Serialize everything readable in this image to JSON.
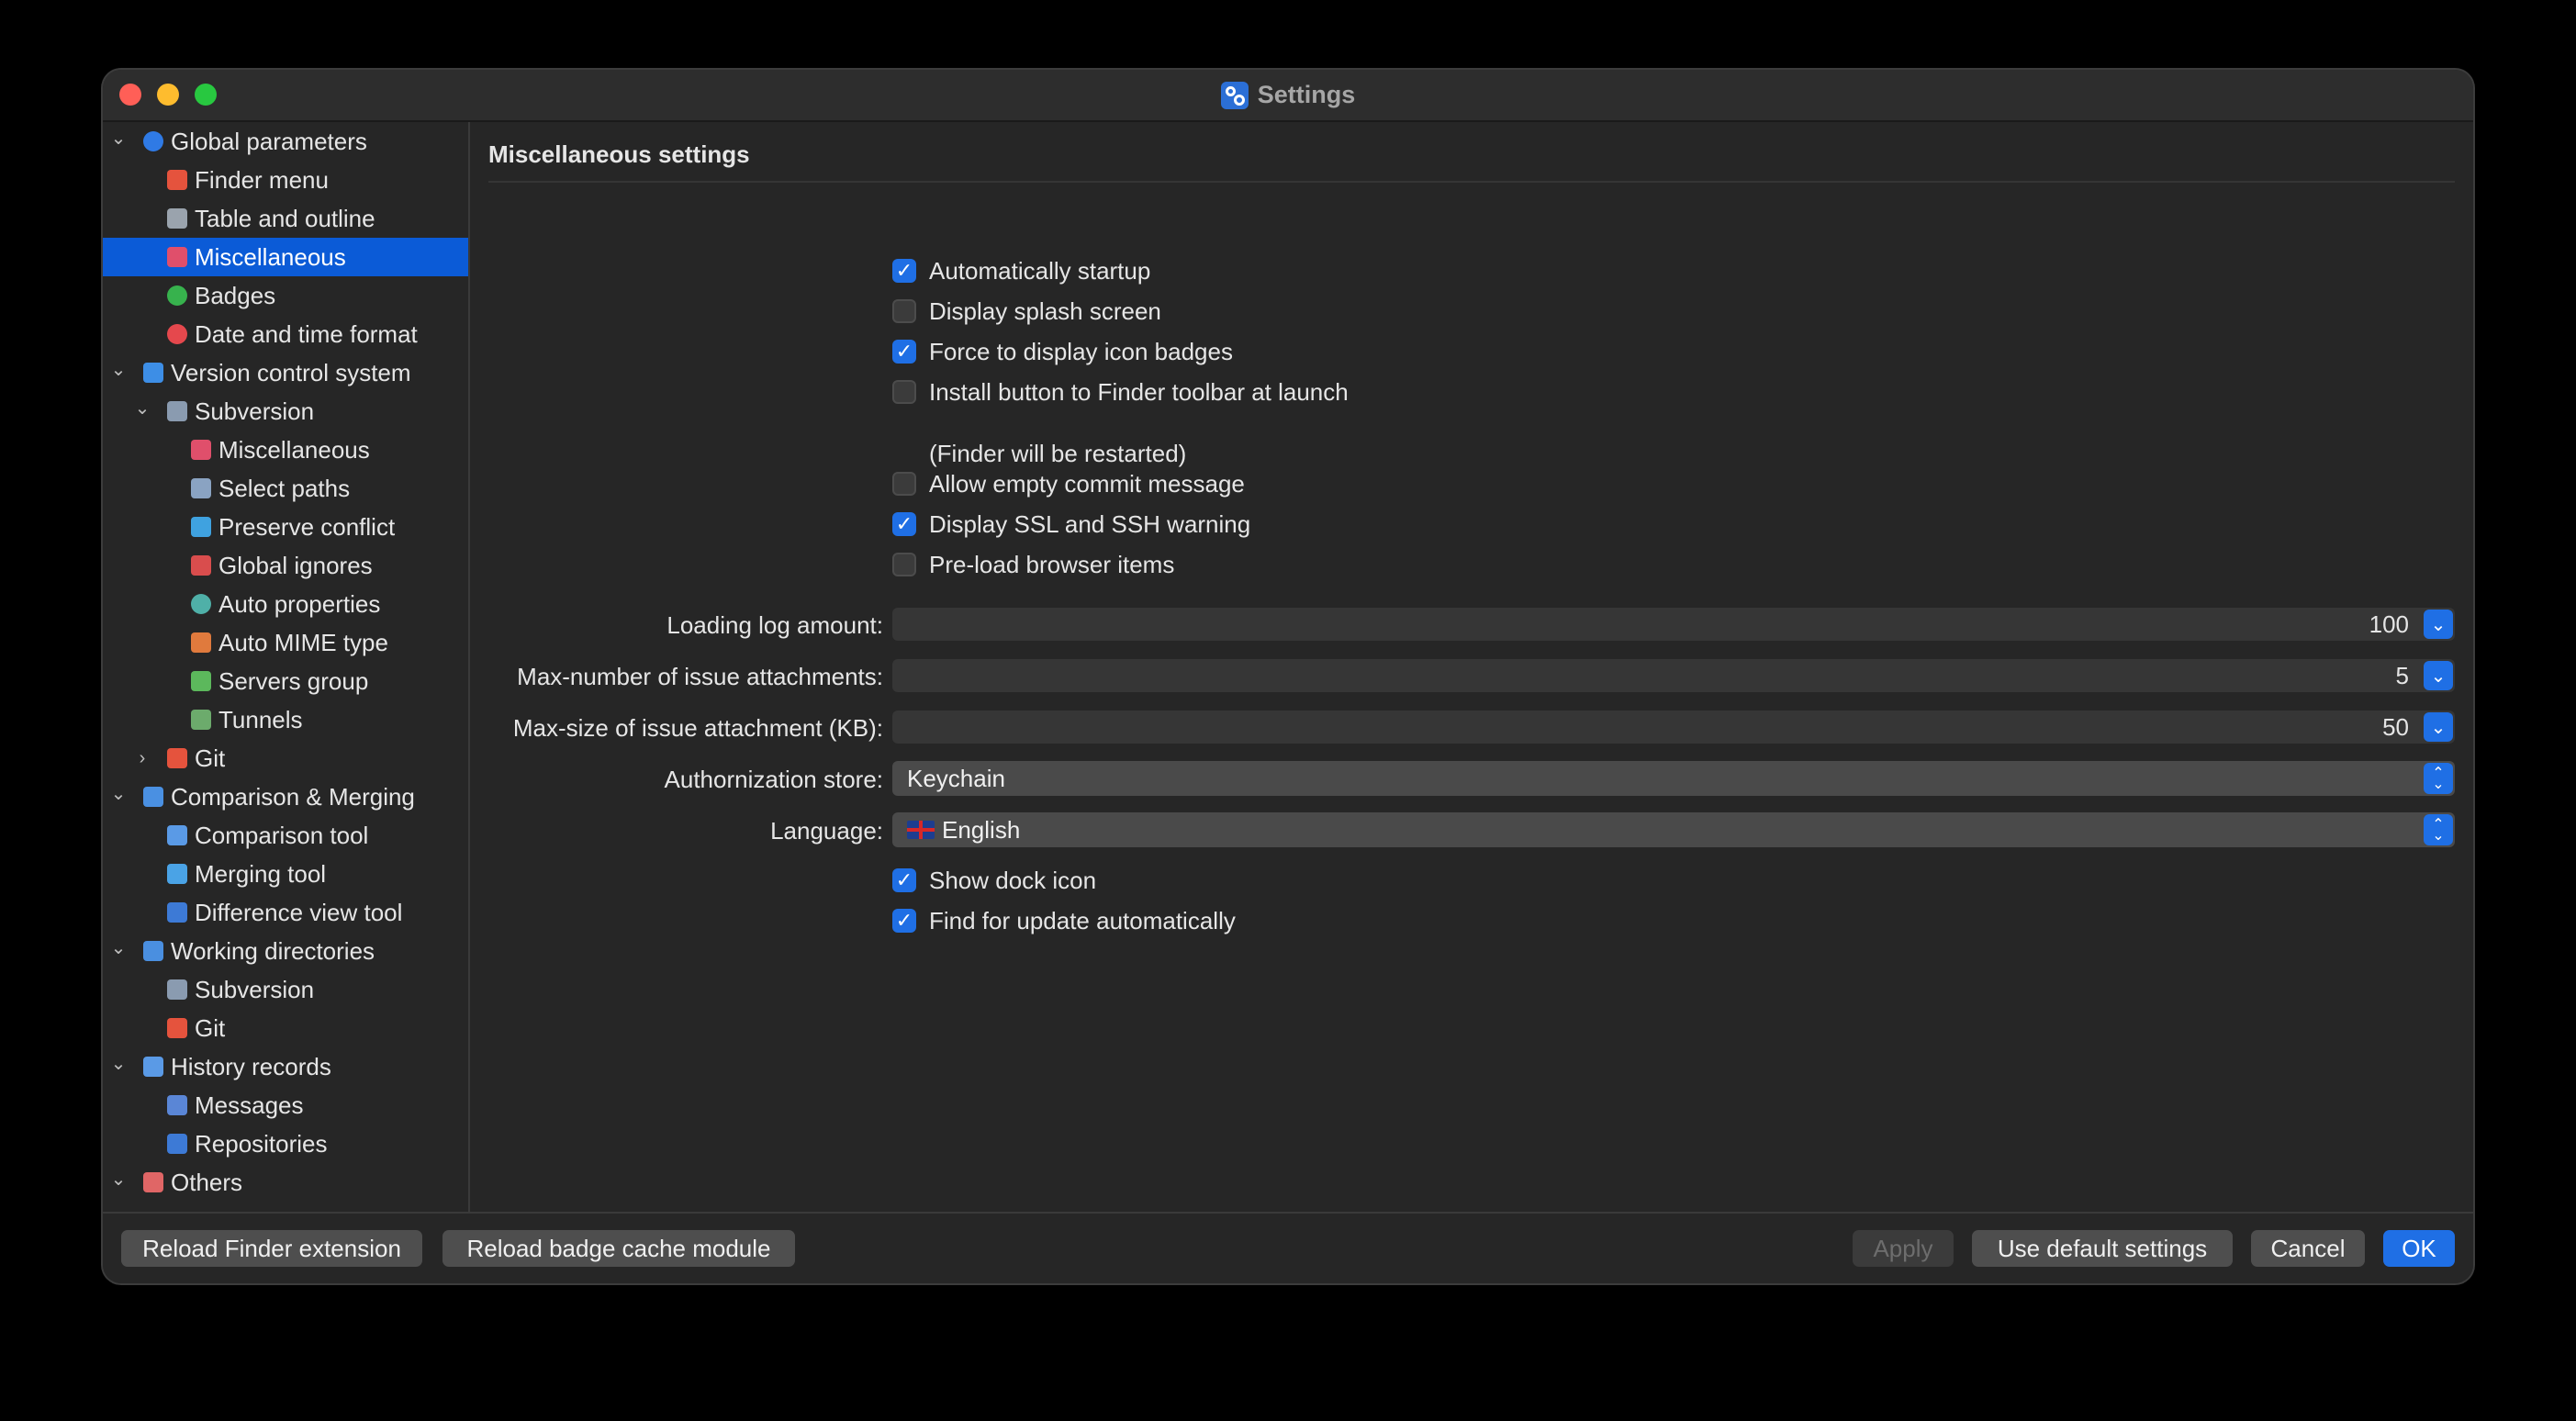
{
  "window": {
    "title": "Settings"
  },
  "sidebar": {
    "items": [
      {
        "label": "Global parameters",
        "level": 0,
        "expander": "expanded",
        "icon": "globe-icon",
        "color": "#2f7ae5"
      },
      {
        "label": "Finder menu",
        "level": 1,
        "expander": "none",
        "icon": "finder-menu-icon",
        "color": "#e5533d"
      },
      {
        "label": "Table and outline",
        "level": 1,
        "expander": "none",
        "icon": "table-icon",
        "color": "#9aa3ad"
      },
      {
        "label": "Miscellaneous",
        "level": 1,
        "expander": "none",
        "icon": "misc-icon",
        "color": "#e04f6b",
        "selected": true
      },
      {
        "label": "Badges",
        "level": 1,
        "expander": "none",
        "icon": "badge-check-icon",
        "color": "#37b24d"
      },
      {
        "label": "Date and time format",
        "level": 1,
        "expander": "none",
        "icon": "clock-icon",
        "color": "#e5484d"
      },
      {
        "label": "Version control system",
        "level": 0,
        "expander": "expanded",
        "icon": "vcs-icon",
        "color": "#3d8ee6"
      },
      {
        "label": "Subversion",
        "level": 1,
        "expander": "expanded",
        "icon": "subversion-icon",
        "color": "#8a9bb0"
      },
      {
        "label": "Miscellaneous",
        "level": 2,
        "expander": "none",
        "icon": "misc-icon",
        "color": "#e04f6b"
      },
      {
        "label": "Select paths",
        "level": 2,
        "expander": "none",
        "icon": "select-paths-icon",
        "color": "#8aa3c2"
      },
      {
        "label": "Preserve conflict",
        "level": 2,
        "expander": "none",
        "icon": "preserve-conflict-icon",
        "color": "#3fa2e0"
      },
      {
        "label": "Global ignores",
        "level": 2,
        "expander": "none",
        "icon": "global-ignores-icon",
        "color": "#d94d4d"
      },
      {
        "label": "Auto properties",
        "level": 2,
        "expander": "none",
        "icon": "auto-properties-icon",
        "color": "#4fb0a8"
      },
      {
        "label": "Auto MIME type",
        "level": 2,
        "expander": "none",
        "icon": "mime-type-icon",
        "color": "#e07a3d"
      },
      {
        "label": "Servers group",
        "level": 2,
        "expander": "none",
        "icon": "servers-group-icon",
        "color": "#5cb85c"
      },
      {
        "label": "Tunnels",
        "level": 2,
        "expander": "none",
        "icon": "tunnels-icon",
        "color": "#6cab6c"
      },
      {
        "label": "Git",
        "level": 1,
        "expander": "collapsed",
        "icon": "git-icon",
        "color": "#e5533d"
      },
      {
        "label": "Comparison & Merging",
        "level": 0,
        "expander": "expanded",
        "icon": "comparison-icon",
        "color": "#4a90e2"
      },
      {
        "label": "Comparison tool",
        "level": 1,
        "expander": "none",
        "icon": "comparison-tool-icon",
        "color": "#5a9ae6"
      },
      {
        "label": "Merging tool",
        "level": 1,
        "expander": "none",
        "icon": "merging-tool-icon",
        "color": "#4aa3e6"
      },
      {
        "label": "Difference view tool",
        "level": 1,
        "expander": "none",
        "icon": "difference-view-icon",
        "color": "#3d7ad6"
      },
      {
        "label": "Working directories",
        "level": 0,
        "expander": "expanded",
        "icon": "working-directories-icon",
        "color": "#4a8fe0"
      },
      {
        "label": "Subversion",
        "level": 1,
        "expander": "none",
        "icon": "subversion-icon",
        "color": "#8a9bb0"
      },
      {
        "label": "Git",
        "level": 1,
        "expander": "none",
        "icon": "git-icon",
        "color": "#e5533d"
      },
      {
        "label": "History records",
        "level": 0,
        "expander": "expanded",
        "icon": "history-icon",
        "color": "#5a9ae6"
      },
      {
        "label": "Messages",
        "level": 1,
        "expander": "none",
        "icon": "messages-icon",
        "color": "#5a86d6"
      },
      {
        "label": "Repositories",
        "level": 1,
        "expander": "none",
        "icon": "repositories-icon",
        "color": "#3d7ad6"
      },
      {
        "label": "Others",
        "level": 0,
        "expander": "expanded",
        "icon": "others-icon",
        "color": "#e06666"
      }
    ]
  },
  "main": {
    "section_title": "Miscellaneous settings",
    "checkboxes": [
      {
        "label": "Automatically startup",
        "checked": true
      },
      {
        "label": "Display splash screen",
        "checked": false
      },
      {
        "label": "Force to display icon badges",
        "checked": true
      },
      {
        "label": "Install button to Finder toolbar at launch",
        "checked": false
      },
      {
        "label": "Allow empty commit message",
        "checked": false
      },
      {
        "label": "Display SSL and SSH warning",
        "checked": true
      },
      {
        "label": "Pre-load browser items",
        "checked": false
      }
    ],
    "finder_note": "(Finder will be restarted)",
    "fields": {
      "loading_log_amount": {
        "label": "Loading log amount:",
        "value": "100"
      },
      "max_issue_attachments": {
        "label": "Max-number of issue attachments:",
        "value": "5"
      },
      "max_attachment_size": {
        "label": "Max-size of issue attachment (KB):",
        "value": "50"
      },
      "authorization_store": {
        "label": "Authornization store:",
        "value": "Keychain"
      },
      "language": {
        "label": "Language:",
        "value": "English"
      }
    },
    "bottom_checkboxes": [
      {
        "label": "Show dock icon",
        "checked": true
      },
      {
        "label": "Find for update automatically",
        "checked": true
      }
    ]
  },
  "footer": {
    "reload_finder": "Reload Finder extension",
    "reload_badge": "Reload badge cache module",
    "apply": "Apply",
    "use_default": "Use default settings",
    "cancel": "Cancel",
    "ok": "OK"
  }
}
